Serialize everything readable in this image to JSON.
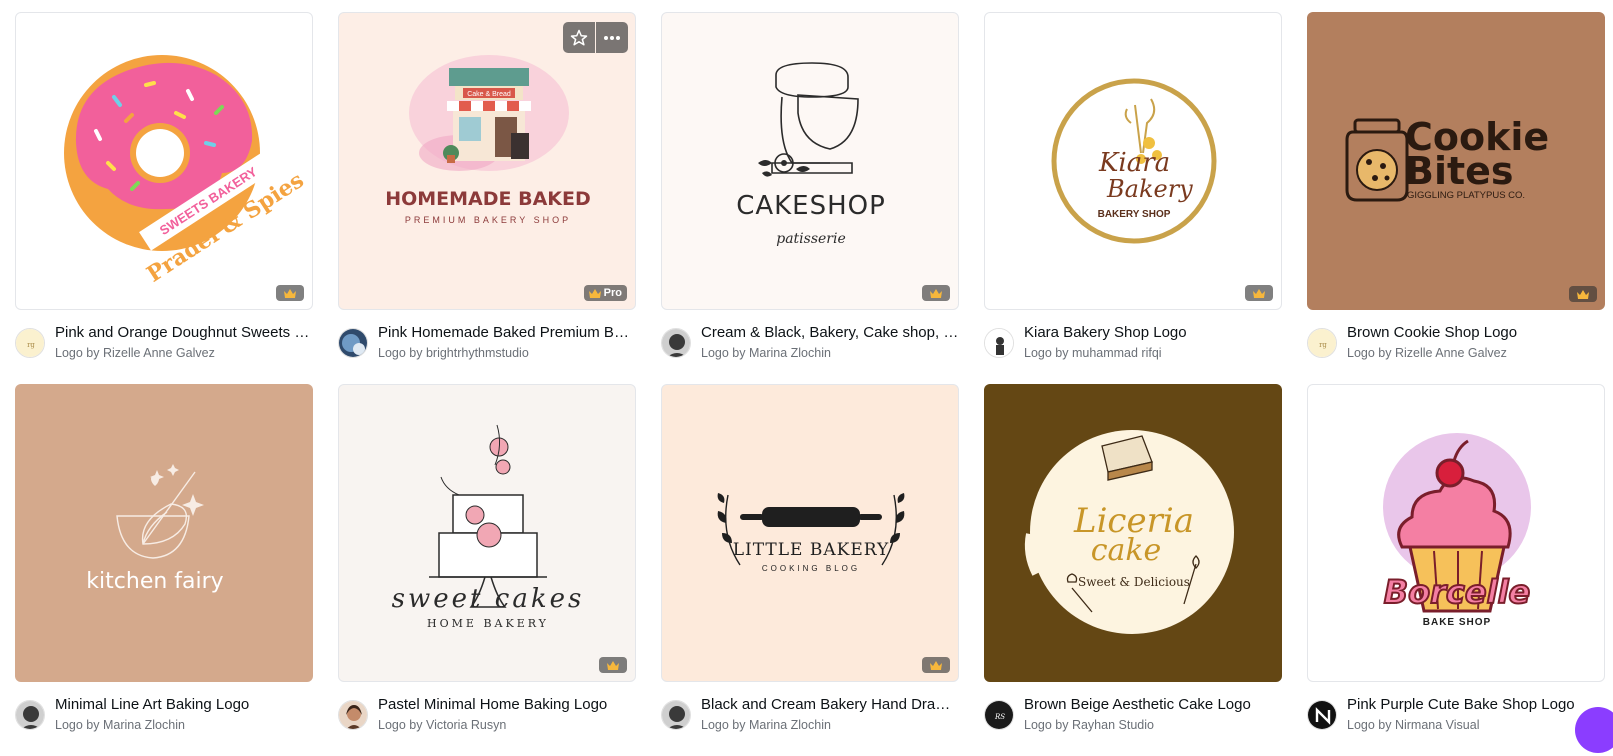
{
  "colors": {
    "accent": "#8b3dff",
    "crown": "#f6b73c",
    "badge_bg": "#4a4a4a"
  },
  "icons": {
    "premium": "crown-icon",
    "favorite": "star-icon",
    "more": "more-dots-icon"
  },
  "badges": {
    "pro": "Pro"
  },
  "templates": [
    {
      "title": "Pink and Orange Doughnut Sweets Bakery Logo",
      "byline": "Logo by Rizelle Anne Galvez",
      "art": {
        "bg": "#ffffff",
        "text1": "SWEETS BAKERY",
        "text2": "Pradel & Spies"
      }
    },
    {
      "title": "Pink Homemade Baked Premium Bakery Shop Logo",
      "byline": "Logo by brightrhythmstudio",
      "art": {
        "bg": "#fdeee6",
        "text1": "HOMEMADE BAKED",
        "text2": "PREMIUM BAKERY SHOP",
        "sign": "Cake & Bread"
      }
    },
    {
      "title": "Cream & Black, Bakery, Cake shop, Patisserie Logo",
      "byline": "Logo by Marina Zlochin",
      "art": {
        "bg": "#fdf8f5",
        "text1": "CAKESHOP",
        "text2": "patisserie"
      }
    },
    {
      "title": "Kiara Bakery Shop Logo",
      "byline": "Logo by muhammad rifqi",
      "art": {
        "bg": "#ffffff",
        "text1": "Kiara",
        "text2": "Bakery",
        "text3": "BAKERY SHOP"
      }
    },
    {
      "title": "Brown Cookie Shop Logo",
      "byline": "Logo by Rizelle Anne Galvez",
      "art": {
        "bg": "#b37f5e",
        "text1": "Cookie",
        "text2": "Bites",
        "text3": "GIGGLING PLATYPUS CO."
      }
    },
    {
      "title": "Minimal Line Art Baking Logo",
      "byline": "Logo by Marina Zlochin",
      "art": {
        "bg": "#d4a98c",
        "text1": "kitchen fairy"
      }
    },
    {
      "title": "Pastel Minimal Home Baking Logo",
      "byline": "Logo by Victoria Rusyn",
      "art": {
        "bg": "#f8f4f1",
        "text1": "sweet cakes",
        "text2": "HOME BAKERY"
      }
    },
    {
      "title": "Black and Cream Bakery Hand Drawn Logo",
      "byline": "Logo by Marina Zlochin",
      "art": {
        "bg": "#fdeadb",
        "text1": "LITTLE BAKERY",
        "text2": "COOKING BLOG"
      }
    },
    {
      "title": "Brown Beige Aesthetic Cake Logo",
      "byline": "Logo by Rayhan Studio",
      "art": {
        "bg": "#644714",
        "text1": "Liceria",
        "text2": "cake",
        "text3": "Sweet & Delicious"
      }
    },
    {
      "title": "Pink Purple Cute Bake Shop Logo",
      "byline": "Logo by Nirmana Visual",
      "art": {
        "bg": "#ffffff",
        "text1": "Borcelle",
        "text2": "BAKE SHOP"
      }
    }
  ]
}
